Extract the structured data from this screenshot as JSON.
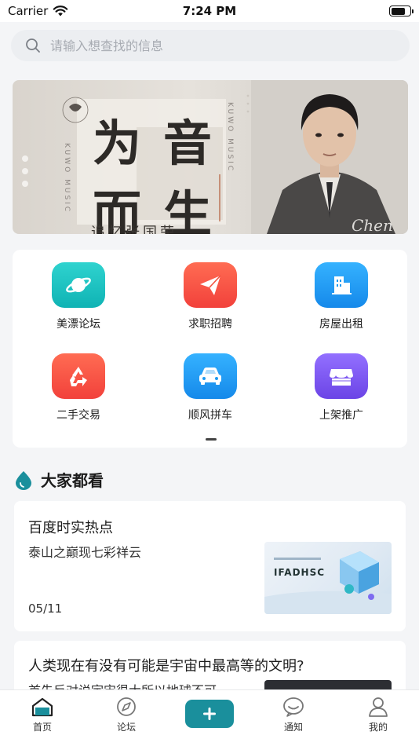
{
  "status_bar": {
    "carrier": "Carrier",
    "time": "7:24 PM"
  },
  "search": {
    "placeholder": "请输入想查找的信息"
  },
  "banner": {
    "title_chars": [
      "为",
      "音",
      "而",
      "生"
    ],
    "brand_vertical": "KUWO MUSIC",
    "subtitle": "追忆张国荣"
  },
  "services": [
    {
      "label": "美漂论坛",
      "icon": "planet-icon",
      "color": "#14c2c0"
    },
    {
      "label": "求职招聘",
      "icon": "paper-plane-icon",
      "color": "#f5523f"
    },
    {
      "label": "房屋出租",
      "icon": "building-icon",
      "color": "#1f9bf2"
    },
    {
      "label": "二手交易",
      "icon": "recycle-icon",
      "color": "#f5523f"
    },
    {
      "label": "顺风拼车",
      "icon": "car-icon",
      "color": "#1f9bf2"
    },
    {
      "label": "上架推广",
      "icon": "store-icon",
      "color": "#7c57ee"
    }
  ],
  "section": {
    "title": "大家都看"
  },
  "feed": [
    {
      "title": "百度时实热点",
      "desc": "泰山之巅现七彩祥云",
      "date": "05/11",
      "thumb_text": "IFADHSC"
    },
    {
      "title": "人类现在有没有可能是宇宙中最高等的文明?",
      "desc": "首先反对说宇宙很大所以地球不可",
      "date": ""
    }
  ],
  "tabs": [
    {
      "label": "首页",
      "icon": "home-icon"
    },
    {
      "label": "论坛",
      "icon": "compass-icon"
    },
    {
      "label": "",
      "icon": "plus-icon"
    },
    {
      "label": "通知",
      "icon": "chat-icon"
    },
    {
      "label": "我的",
      "icon": "user-icon"
    }
  ],
  "colors": {
    "accent": "#1a8f9c",
    "background": "#f4f5f7"
  }
}
